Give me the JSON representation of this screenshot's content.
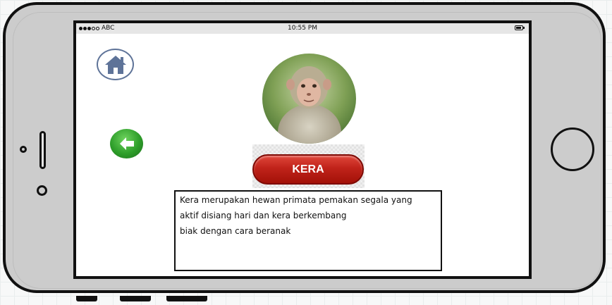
{
  "status_bar": {
    "carrier": "ABC",
    "time": "10:55 PM",
    "signal_filled": 3,
    "signal_total": 5
  },
  "navigation": {
    "home_icon": "home-icon",
    "back_icon": "arrow-left-icon"
  },
  "animal": {
    "photo_icon": "monkey-photo",
    "name": "KERA",
    "description_lines": [
      "Kera merupakan hewan primata pemakan segala yang",
      "aktif disiang hari dan kera berkembang",
      "biak dengan cara beranak"
    ]
  },
  "colors": {
    "title_button": "#c0231a",
    "back_button": "#2e9e2a",
    "home_icon": "#5e7398"
  }
}
